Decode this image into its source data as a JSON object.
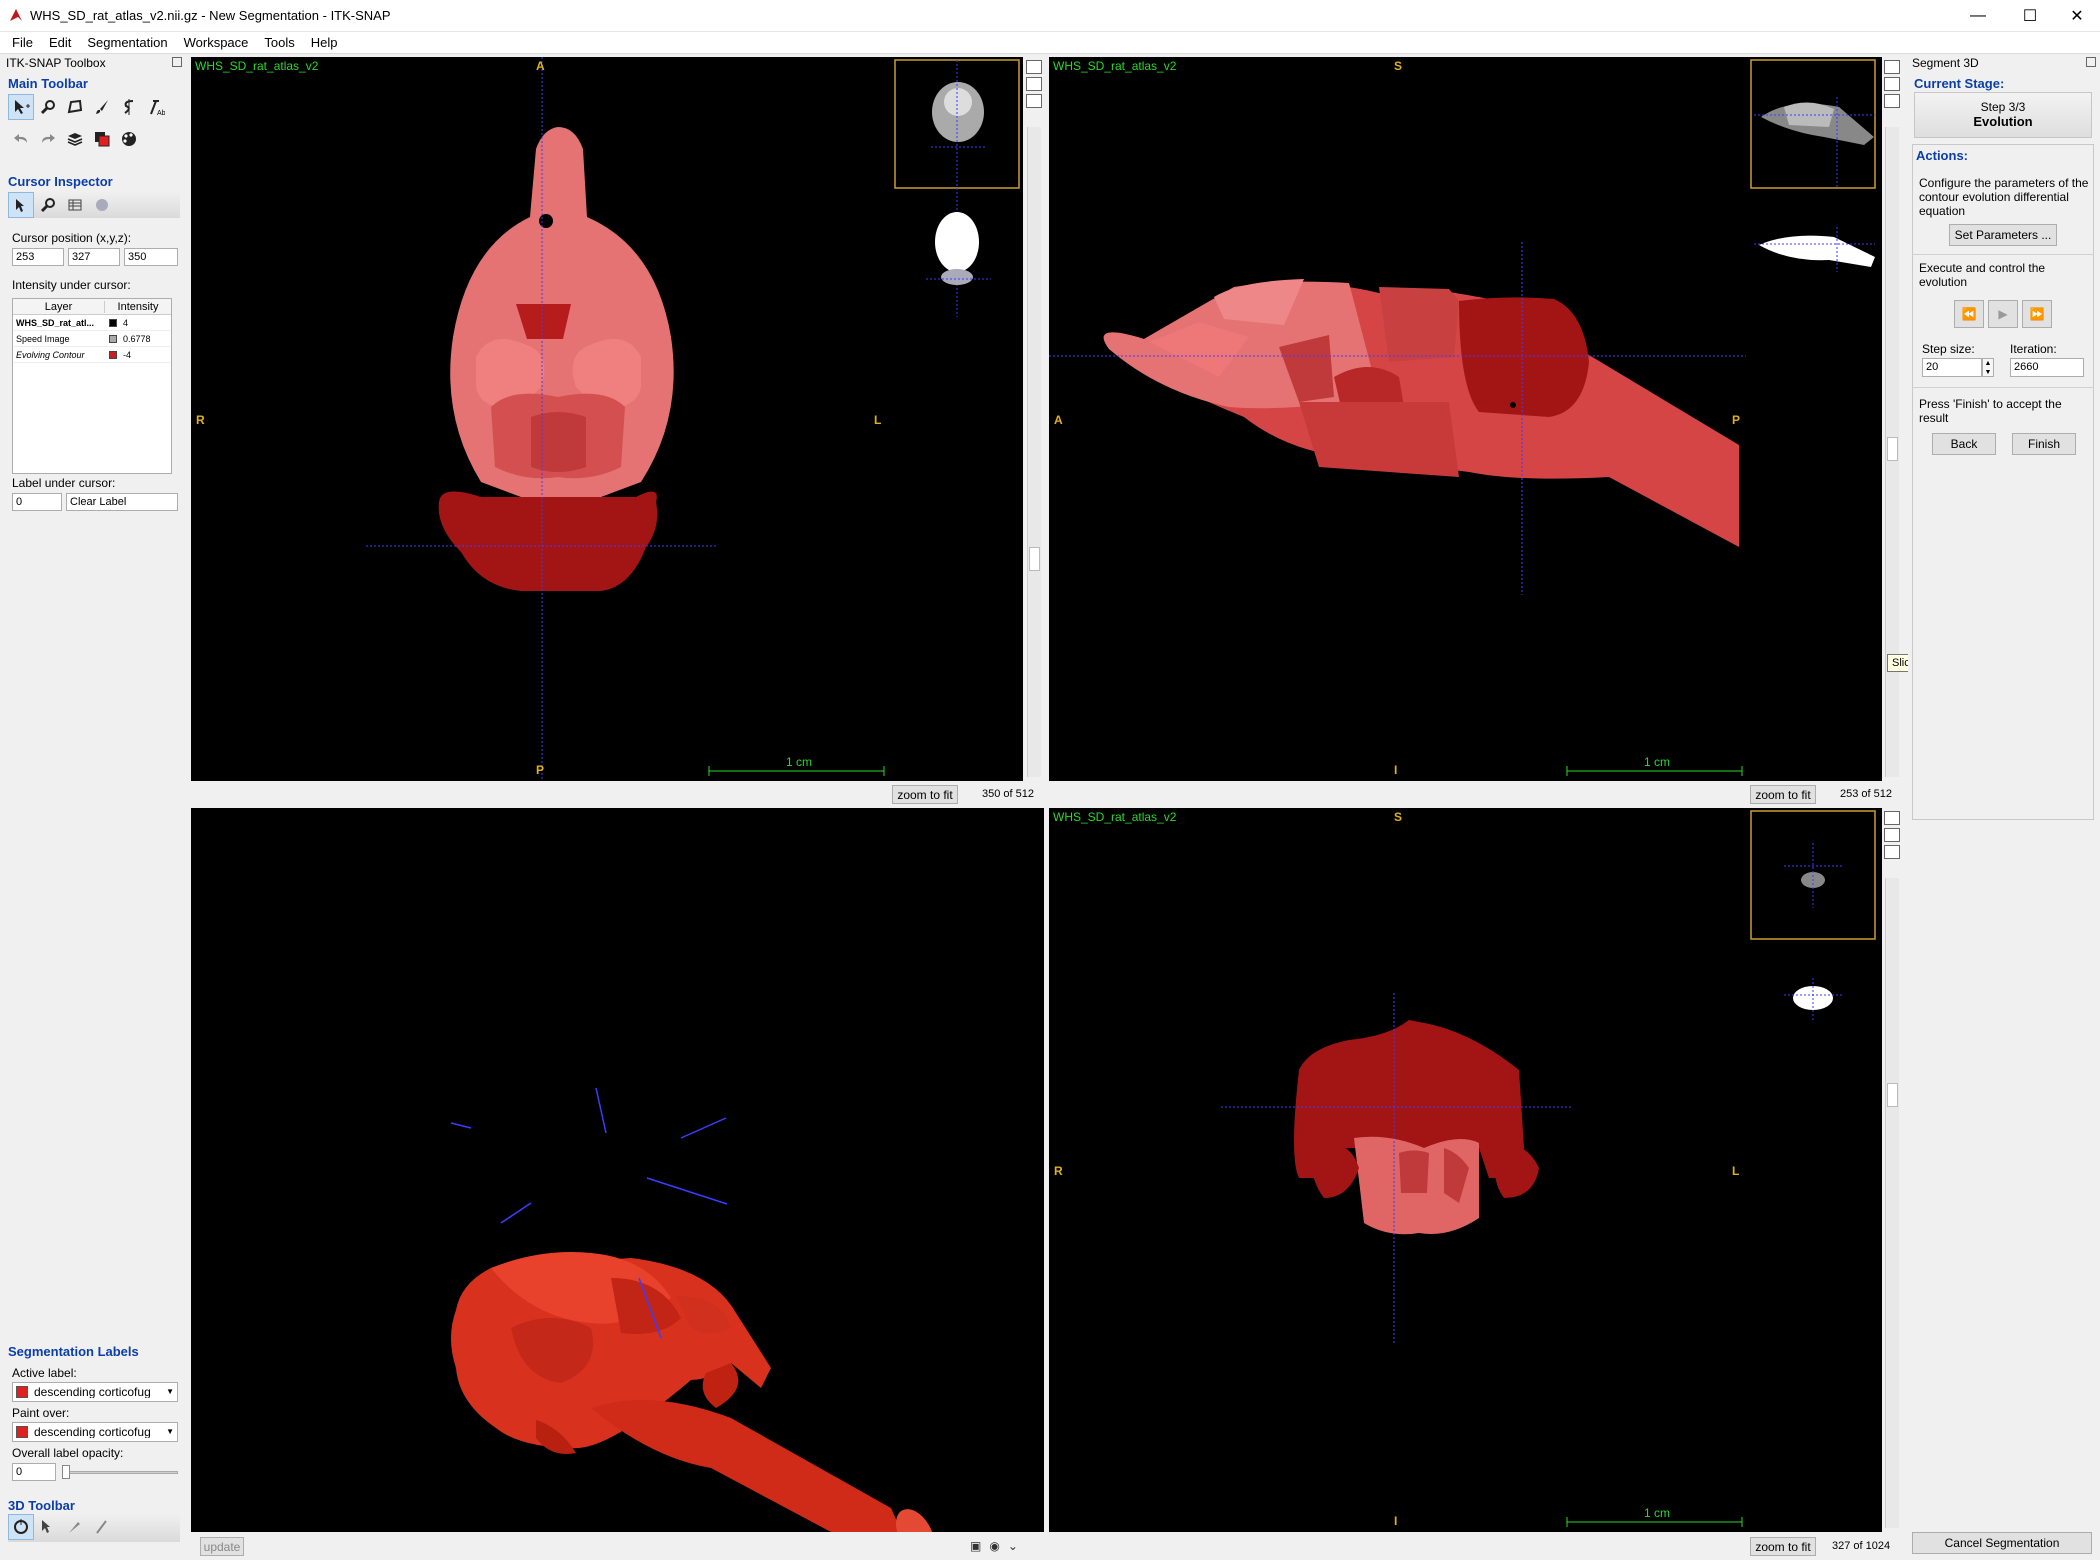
{
  "window": {
    "title": "WHS_SD_rat_atlas_v2.nii.gz - New Segmentation - ITK-SNAP",
    "minimize": "—",
    "maximize": "☐",
    "close": "✕"
  },
  "menu": [
    "File",
    "Edit",
    "Segmentation",
    "Workspace",
    "Tools",
    "Help"
  ],
  "toolbox": {
    "title": "ITK-SNAP Toolbox",
    "main_toolbar": "Main Toolbar",
    "cursor_inspector": "Cursor Inspector",
    "cursor_position_label": "Cursor position (x,y,z):",
    "cursor_x": "253",
    "cursor_y": "327",
    "cursor_z": "350",
    "intensity_label": "Intensity under cursor:",
    "table_headers": [
      "Layer",
      "Intensity"
    ],
    "table_rows": [
      {
        "layer": "WHS_SD_rat_atl...",
        "value": "4",
        "swatch": "#000000",
        "style": "bold"
      },
      {
        "layer": "Speed Image",
        "value": "0.6778",
        "swatch": "#aaaaaa",
        "style": "normal"
      },
      {
        "layer": "Evolving Contour",
        "value": "-4",
        "swatch": "#c82020",
        "style": "italic"
      }
    ],
    "label_under_cursor": "Label under cursor:",
    "label_value": "0",
    "label_name": "Clear Label",
    "seg_labels_title": "Segmentation Labels",
    "active_label_title": "Active label:",
    "active_label": "descending corticofug",
    "paint_over_title": "Paint over:",
    "paint_over": "descending corticofug",
    "opacity_title": "Overall label opacity:",
    "opacity_value": "0",
    "toolbar_3d": "3D Toolbar"
  },
  "views": {
    "axial": {
      "layer": "WHS_SD_rat_atlas_v2",
      "top": "A",
      "bottom": "P",
      "left": "R",
      "right": "L",
      "scale": "1 cm",
      "zoom": "zoom to fit",
      "slice": "350 of 512"
    },
    "sagittal": {
      "layer": "WHS_SD_rat_atlas_v2",
      "top": "S",
      "bottom": "I",
      "left": "A",
      "right": "P",
      "scale": "1 cm",
      "zoom": "zoom to fit",
      "slice": "253 of 512"
    },
    "coronal": {
      "layer": "WHS_SD_rat_atlas_v2",
      "top": "S",
      "bottom": "I",
      "left": "R",
      "right": "L",
      "scale": "1 cm",
      "zoom": "zoom to fit",
      "slice": "327 of 1024"
    },
    "render3d": {
      "update": "update"
    }
  },
  "segment3d": {
    "title": "Segment 3D",
    "current_stage": "Current Stage:",
    "step": "Step 3/3",
    "stage_name": "Evolution",
    "actions": "Actions:",
    "configure_text": "Configure the parameters of the contour evolution differential equation",
    "set_params": "Set Parameters ...",
    "execute_text": "Execute and control the evolution",
    "step_size_label": "Step size:",
    "step_size": "20",
    "iteration_label": "Iteration:",
    "iteration": "2660",
    "finish_text": "Press 'Finish' to accept the result",
    "back": "Back",
    "finish": "Finish",
    "cancel": "Cancel Segmentation"
  },
  "tooltip": "Slice selection",
  "colors": {
    "accent": "#0b3ea8",
    "label_green": "#2ad92a",
    "orient": "#e0b020",
    "crosshair": "#3c3cff",
    "seg_red": "#cc2a2a"
  }
}
